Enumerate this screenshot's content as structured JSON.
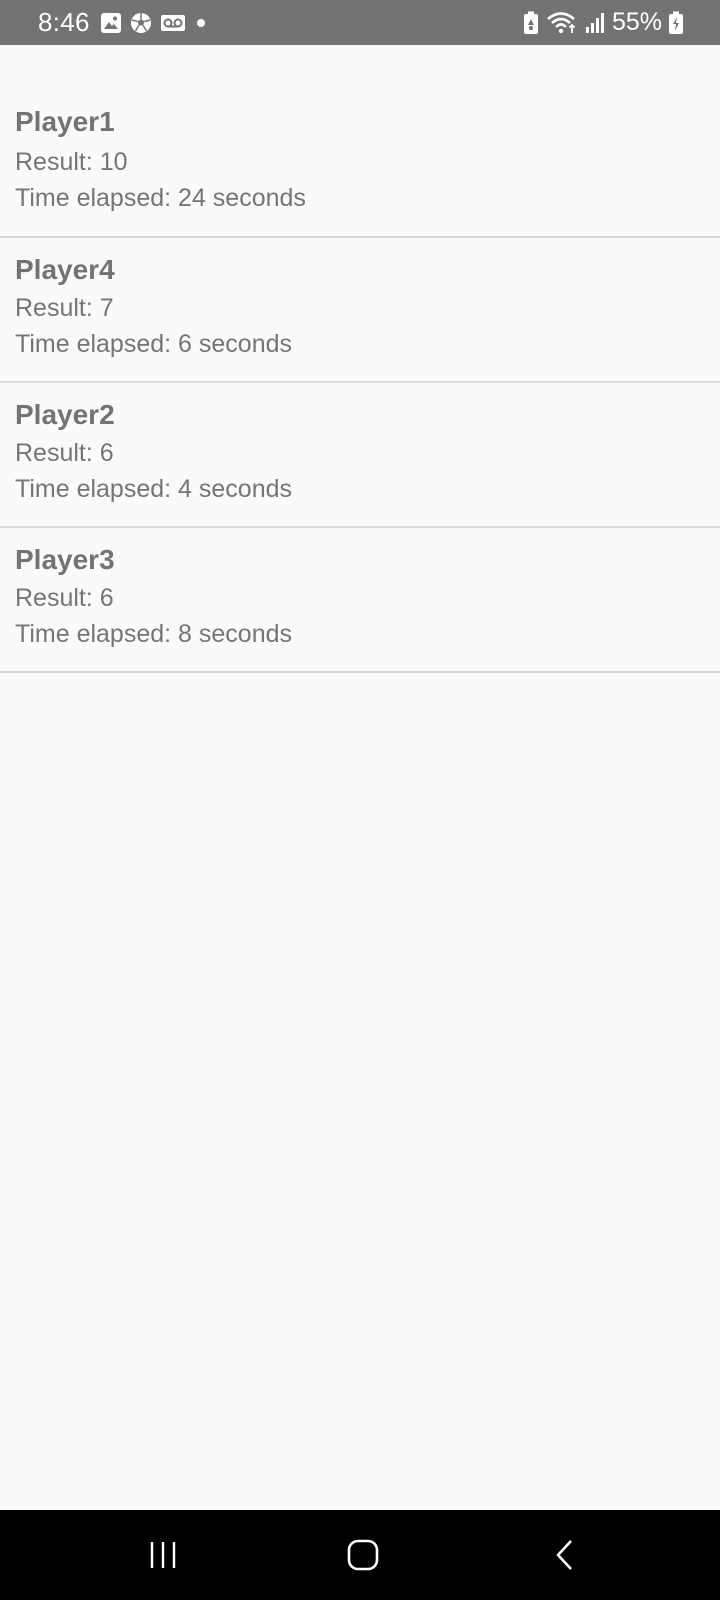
{
  "status_bar": {
    "time": "8:46",
    "battery_percent": "55%",
    "left_icons": [
      "gallery-icon",
      "soccer-ball-icon",
      "voicemail-icon",
      "dot-icon"
    ],
    "right_icons": [
      "battery-saver-icon",
      "wifi-icon",
      "signal-icon",
      "battery-icon"
    ]
  },
  "results": [
    {
      "name": "Player1",
      "result": "Result: 10",
      "time": "Time elapsed: 24 seconds"
    },
    {
      "name": "Player4",
      "result": "Result: 7",
      "time": "Time elapsed: 6 seconds"
    },
    {
      "name": "Player2",
      "result": "Result: 6",
      "time": "Time elapsed: 4 seconds"
    },
    {
      "name": "Player3",
      "result": "Result: 6",
      "time": "Time elapsed: 8 seconds"
    }
  ],
  "nav_bar": {
    "icons": [
      "recent-apps-icon",
      "home-icon",
      "back-icon"
    ]
  },
  "colors": {
    "status_bar": "#737373",
    "background": "#fafafa",
    "divider": "#d9d9d9",
    "name_text": "#737373",
    "detail_text": "#757575",
    "nav_bar": "#000000"
  }
}
